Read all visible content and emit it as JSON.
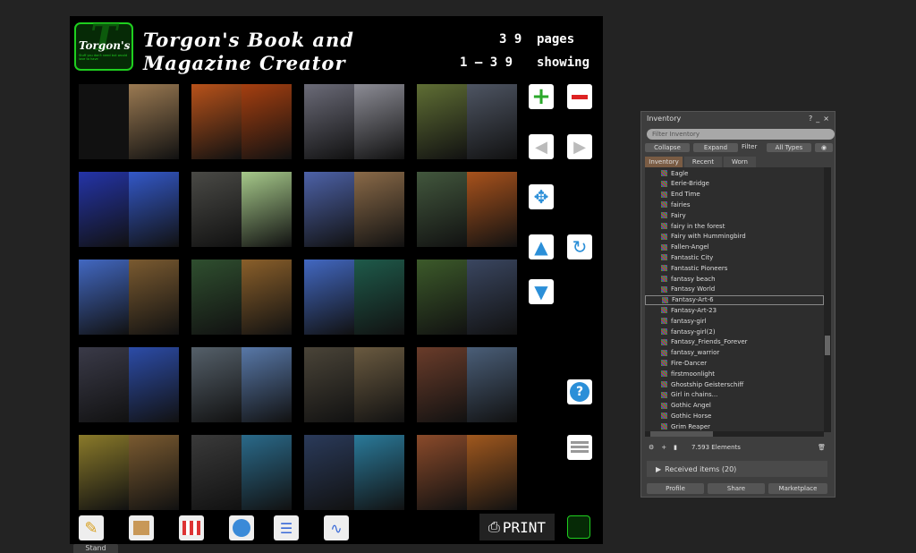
{
  "hud": {
    "title_line1": "Torgon's Book and",
    "title_line2": "Magazine Creator",
    "logo_text": "Torgon's",
    "logo_tagline": "Stuff you don't need but would love to have",
    "pages_count": "3 9",
    "pages_label": "pages",
    "showing_range": "1 – 3 9",
    "showing_label": "showing",
    "print_label": "PRINT",
    "stand_label": "Stand"
  },
  "books": [
    {
      "left": "#111",
      "right": "#9b7a52"
    },
    {
      "left": "#b8521a",
      "right": "#a63f10"
    },
    {
      "left": "#6b6b78",
      "right": "#8c8c95"
    },
    {
      "left": "#5f6e34",
      "right": "#4e5563"
    },
    {
      "left": "#2434a8",
      "right": "#3358c8"
    },
    {
      "left": "#4a4a46",
      "right": "#a6c98a"
    },
    {
      "left": "#4d62a8",
      "right": "#8a6a48"
    },
    {
      "left": "#42573d",
      "right": "#a8521c"
    },
    {
      "left": "#4268c2",
      "right": "#7a5a30"
    },
    {
      "left": "#2f4f2f",
      "right": "#8a5f2a"
    },
    {
      "left": "#4268c2",
      "right": "#1e5a4a"
    },
    {
      "left": "#3c5a2a",
      "right": "#3a4660"
    },
    {
      "left": "#3a3a48",
      "right": "#2c4ca8"
    },
    {
      "left": "#55606a",
      "right": "#5878a8"
    },
    {
      "left": "#4a4438",
      "right": "#6a5a40"
    },
    {
      "left": "#6a3c2a",
      "right": "#4a5e78"
    },
    {
      "left": "#8a7a2a",
      "right": "#7a5a30"
    },
    {
      "left": "#3a3a3a",
      "right": "#2a6a8a"
    },
    {
      "left": "#2a3a5a",
      "right": "#2a7a9a"
    },
    {
      "left": "#8a4a2a",
      "right": "#a0581e"
    }
  ],
  "inventory": {
    "title": "Inventory",
    "help": "?",
    "minimize": "_",
    "close": "×",
    "filter_placeholder": "Filter Inventory",
    "collapse": "Collapse",
    "expand": "Expand",
    "filter_label": "Filter",
    "filter_value": "All Types",
    "tabs": [
      "Inventory",
      "Recent",
      "Worn"
    ],
    "items": [
      "Eagle",
      "Eerie-Bridge",
      "End Time",
      "fairies",
      "Fairy",
      "fairy in the forest",
      "Fairy with Hummingbird",
      "Fallen-Angel",
      "Fantastic City",
      "Fantastic Pioneers",
      "fantasy beach",
      "Fantasy World",
      "Fantasy-Art-6",
      "Fantasy-Art-23",
      "fantasy-girl",
      "fantasy-girl(2)",
      "Fantasy_Friends_Forever",
      "fantasy_warrior",
      "Fire-Dancer",
      "firstmoonlight",
      "Ghostship  Geisterschiff",
      "Girl in chains...",
      "Gothic Angel",
      "Gothic Horse",
      "Grim Reaper"
    ],
    "selected_index": 12,
    "element_count": "7.593 Elements",
    "received": "Received items (20)",
    "buttons": [
      "Profile",
      "Share",
      "Marketplace"
    ]
  }
}
